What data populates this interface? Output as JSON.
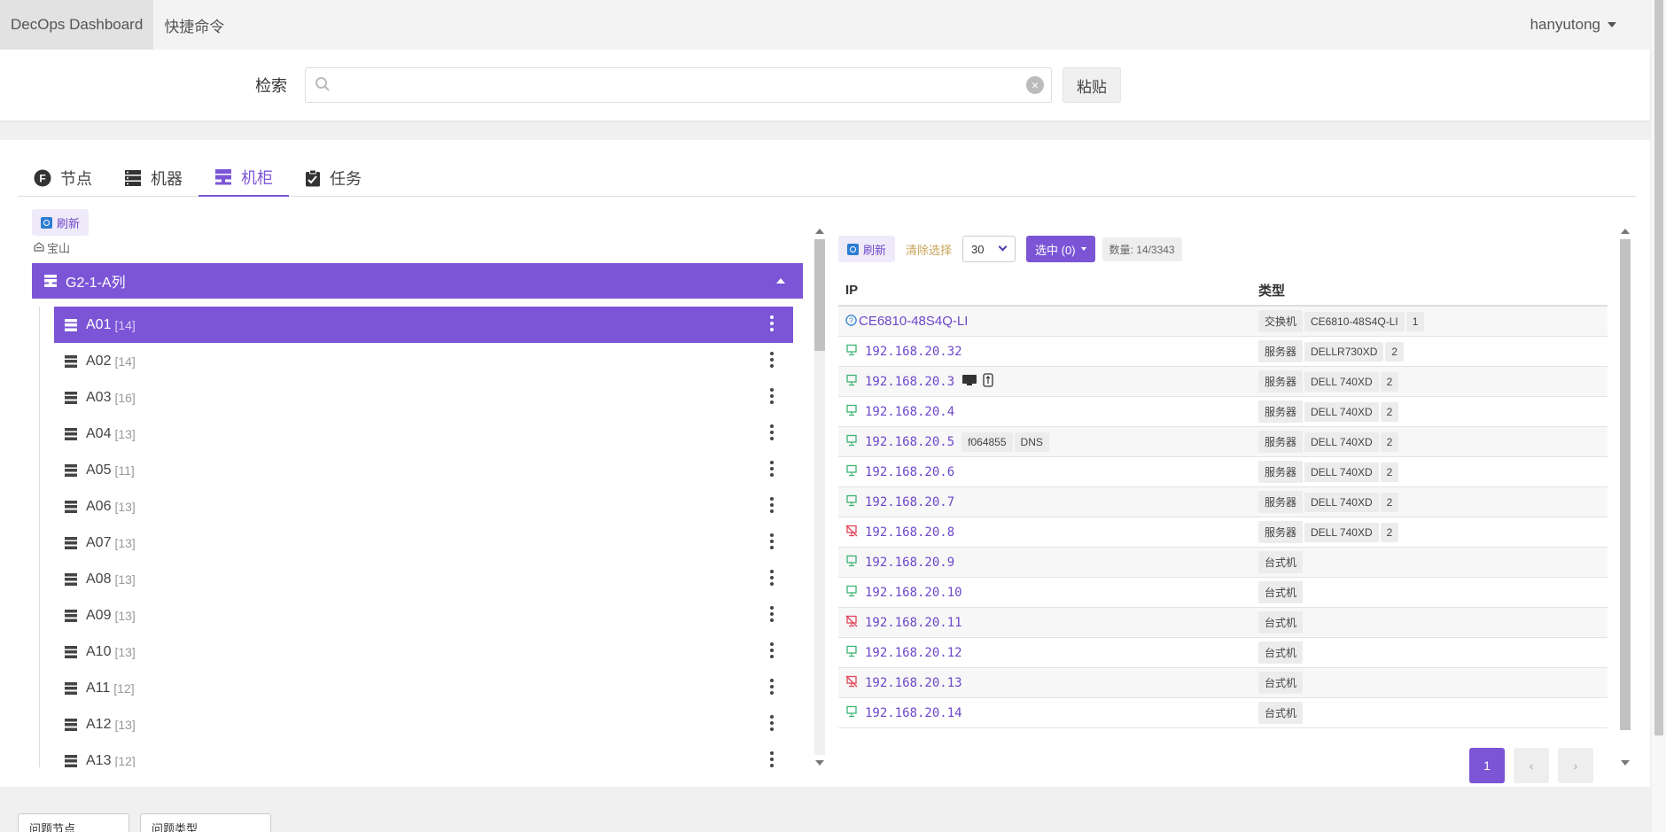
{
  "topbar": {
    "brand": "DecOps Dashboard",
    "nav_link": "快捷命令",
    "user": "hanyutong"
  },
  "search": {
    "label": "检索",
    "value": "",
    "placeholder": "",
    "paste_label": "粘贴"
  },
  "tabs": [
    {
      "label": "节点",
      "icon": "f-circle-icon"
    },
    {
      "label": "机器",
      "icon": "server-stack-icon"
    },
    {
      "label": "机柜",
      "icon": "rack-icon",
      "active": true
    },
    {
      "label": "任务",
      "icon": "clipboard-icon"
    }
  ],
  "left": {
    "refresh_label": "刷新",
    "location": "宝山",
    "group": "G2-1-A列",
    "racks": [
      {
        "name": "A01",
        "count": "[14]",
        "active": true
      },
      {
        "name": "A02",
        "count": "[14]"
      },
      {
        "name": "A03",
        "count": "[16]"
      },
      {
        "name": "A04",
        "count": "[13]"
      },
      {
        "name": "A05",
        "count": "[11]"
      },
      {
        "name": "A06",
        "count": "[13]"
      },
      {
        "name": "A07",
        "count": "[13]"
      },
      {
        "name": "A08",
        "count": "[13]"
      },
      {
        "name": "A09",
        "count": "[13]"
      },
      {
        "name": "A10",
        "count": "[13]"
      },
      {
        "name": "A11",
        "count": "[12]"
      },
      {
        "name": "A12",
        "count": "[13]"
      },
      {
        "name": "A13",
        "count": "[12]"
      }
    ]
  },
  "right": {
    "refresh_label": "刷新",
    "clear_label": "清除选择",
    "page_size": "30",
    "selected_label": "选中 (0)",
    "count_label": "数量: 14/3343",
    "columns": [
      "IP",
      "类型"
    ],
    "rows": [
      {
        "ip": "CE6810-48S4Q-LI",
        "status": "unknown",
        "kind": "switch",
        "type_tags": [
          "交换机",
          "CE6810-48S4Q-LI",
          "1"
        ]
      },
      {
        "ip": "192.168.20.32",
        "status": "online",
        "type_tags": [
          "服务器",
          "DELLR730XD",
          "2"
        ]
      },
      {
        "ip": "192.168.20.3",
        "status": "online",
        "extra_icons": [
          "monitor-icon",
          "usb-icon"
        ],
        "type_tags": [
          "服务器",
          "DELL 740XD",
          "2"
        ]
      },
      {
        "ip": "192.168.20.4",
        "status": "online",
        "type_tags": [
          "服务器",
          "DELL 740XD",
          "2"
        ]
      },
      {
        "ip": "192.168.20.5",
        "status": "online",
        "ip_tags": [
          "f064855",
          "DNS"
        ],
        "type_tags": [
          "服务器",
          "DELL 740XD",
          "2"
        ]
      },
      {
        "ip": "192.168.20.6",
        "status": "online",
        "type_tags": [
          "服务器",
          "DELL 740XD",
          "2"
        ]
      },
      {
        "ip": "192.168.20.7",
        "status": "online",
        "type_tags": [
          "服务器",
          "DELL 740XD",
          "2"
        ]
      },
      {
        "ip": "192.168.20.8",
        "status": "offline",
        "type_tags": [
          "服务器",
          "DELL 740XD",
          "2"
        ]
      },
      {
        "ip": "192.168.20.9",
        "status": "online",
        "type_tags": [
          "台式机"
        ]
      },
      {
        "ip": "192.168.20.10",
        "status": "online",
        "type_tags": [
          "台式机"
        ]
      },
      {
        "ip": "192.168.20.11",
        "status": "offline",
        "type_tags": [
          "台式机"
        ]
      },
      {
        "ip": "192.168.20.12",
        "status": "online",
        "type_tags": [
          "台式机"
        ]
      },
      {
        "ip": "192.168.20.13",
        "status": "offline",
        "type_tags": [
          "台式机"
        ]
      },
      {
        "ip": "192.168.20.14",
        "status": "online",
        "type_tags": [
          "台式机"
        ]
      }
    ],
    "pagination": {
      "current": "1",
      "prev": "‹",
      "next": "›"
    }
  },
  "bottom": {
    "filter1": "问题节点",
    "filter2": "问题类型"
  },
  "colors": {
    "accent": "#7b55d6",
    "online": "#3cb371",
    "offline": "#e0455a"
  }
}
